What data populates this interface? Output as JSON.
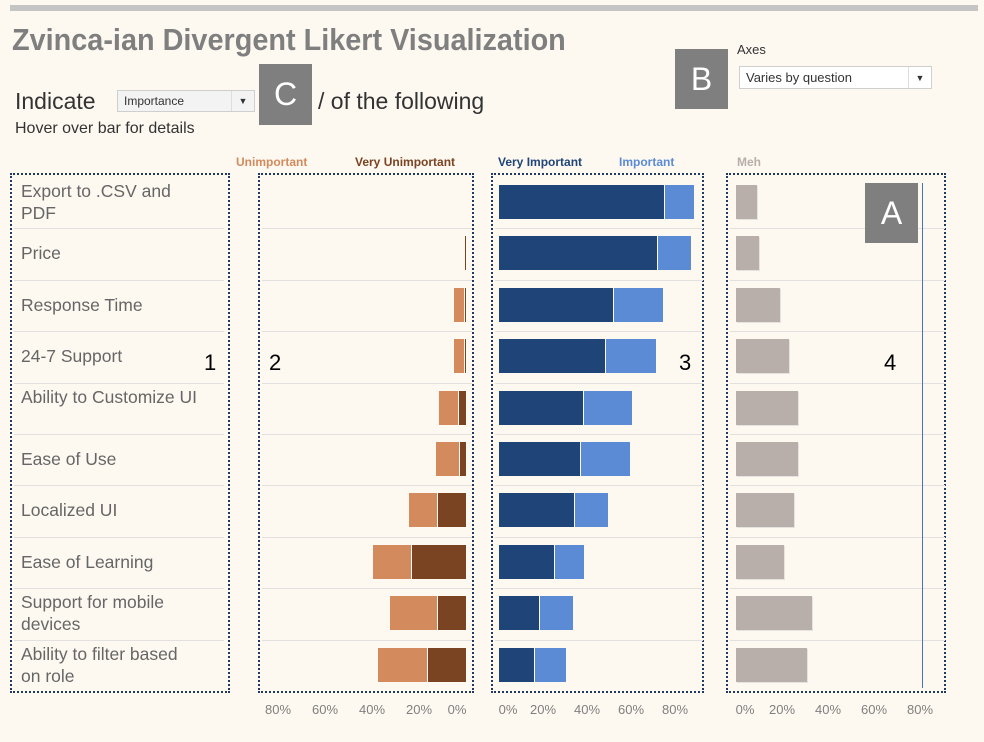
{
  "header": {
    "title": "Zvinca-ian Divergent Likert Visualization",
    "indicate_prefix": "Indicate",
    "indicate_suffix": "/ of the following",
    "hover_hint": "Hover over bar for details"
  },
  "controls": {
    "measure_select": {
      "value": "Importance"
    },
    "axes": {
      "label": "Axes",
      "value": "Varies by question"
    }
  },
  "annotations": {
    "markers": {
      "a": "A",
      "b": "B",
      "c": "C"
    },
    "panel_numbers": [
      "1",
      "2",
      "3",
      "4"
    ]
  },
  "colors": {
    "unimportant": "#d38a5c",
    "very_unimportant": "#7a4322",
    "very_important": "#1f4477",
    "important": "#5b8bd4",
    "meh": "#b8aeaa",
    "reference_line": "#4472c4"
  },
  "chart_data": {
    "type": "bar",
    "title": "Zvinca-ian Divergent Likert Visualization",
    "categories": [
      "Export to .CSV and PDF",
      "Price",
      "Response Time",
      "24-7 Support",
      "Ability to Customize UI",
      "Ease of Use",
      "Localized UI",
      "Ease of Learning",
      "Support for mobile devices",
      "Ability to filter based on role"
    ],
    "legend": [
      "Unimportant",
      "Very Unimportant",
      "Very Important",
      "Important",
      "Meh"
    ],
    "series": [
      {
        "name": "Very Unimportant",
        "panel": "negative",
        "values": [
          0,
          0.5,
          0.5,
          0.5,
          3,
          2.5,
          12,
          23,
          12,
          16
        ]
      },
      {
        "name": "Unimportant",
        "panel": "negative",
        "values": [
          0,
          0,
          4,
          4,
          8,
          10,
          12,
          16,
          20,
          21
        ]
      },
      {
        "name": "Very Important",
        "panel": "positive",
        "values": [
          75,
          72,
          52,
          48,
          38,
          37,
          34,
          25,
          18,
          16
        ]
      },
      {
        "name": "Important",
        "panel": "positive",
        "values": [
          13,
          15,
          22,
          23,
          22,
          22,
          15,
          13,
          15,
          14
        ]
      },
      {
        "name": "Meh",
        "panel": "neutral",
        "values": [
          9,
          10,
          19,
          23,
          27,
          27,
          25,
          21,
          33,
          31
        ]
      }
    ],
    "reference_line": {
      "panel": "neutral",
      "value": 81
    },
    "axes": {
      "negative": {
        "ticks": [
          "80%",
          "60%",
          "40%",
          "20%",
          "0%"
        ],
        "range": [
          80,
          0
        ]
      },
      "positive": {
        "ticks": [
          "0%",
          "20%",
          "40%",
          "60%",
          "80%"
        ],
        "range": [
          0,
          80
        ]
      },
      "neutral": {
        "ticks": [
          "0%",
          "20%",
          "40%",
          "60%",
          "80%"
        ],
        "range": [
          0,
          80
        ]
      }
    },
    "grid": true,
    "xlabel": "",
    "ylabel": ""
  }
}
